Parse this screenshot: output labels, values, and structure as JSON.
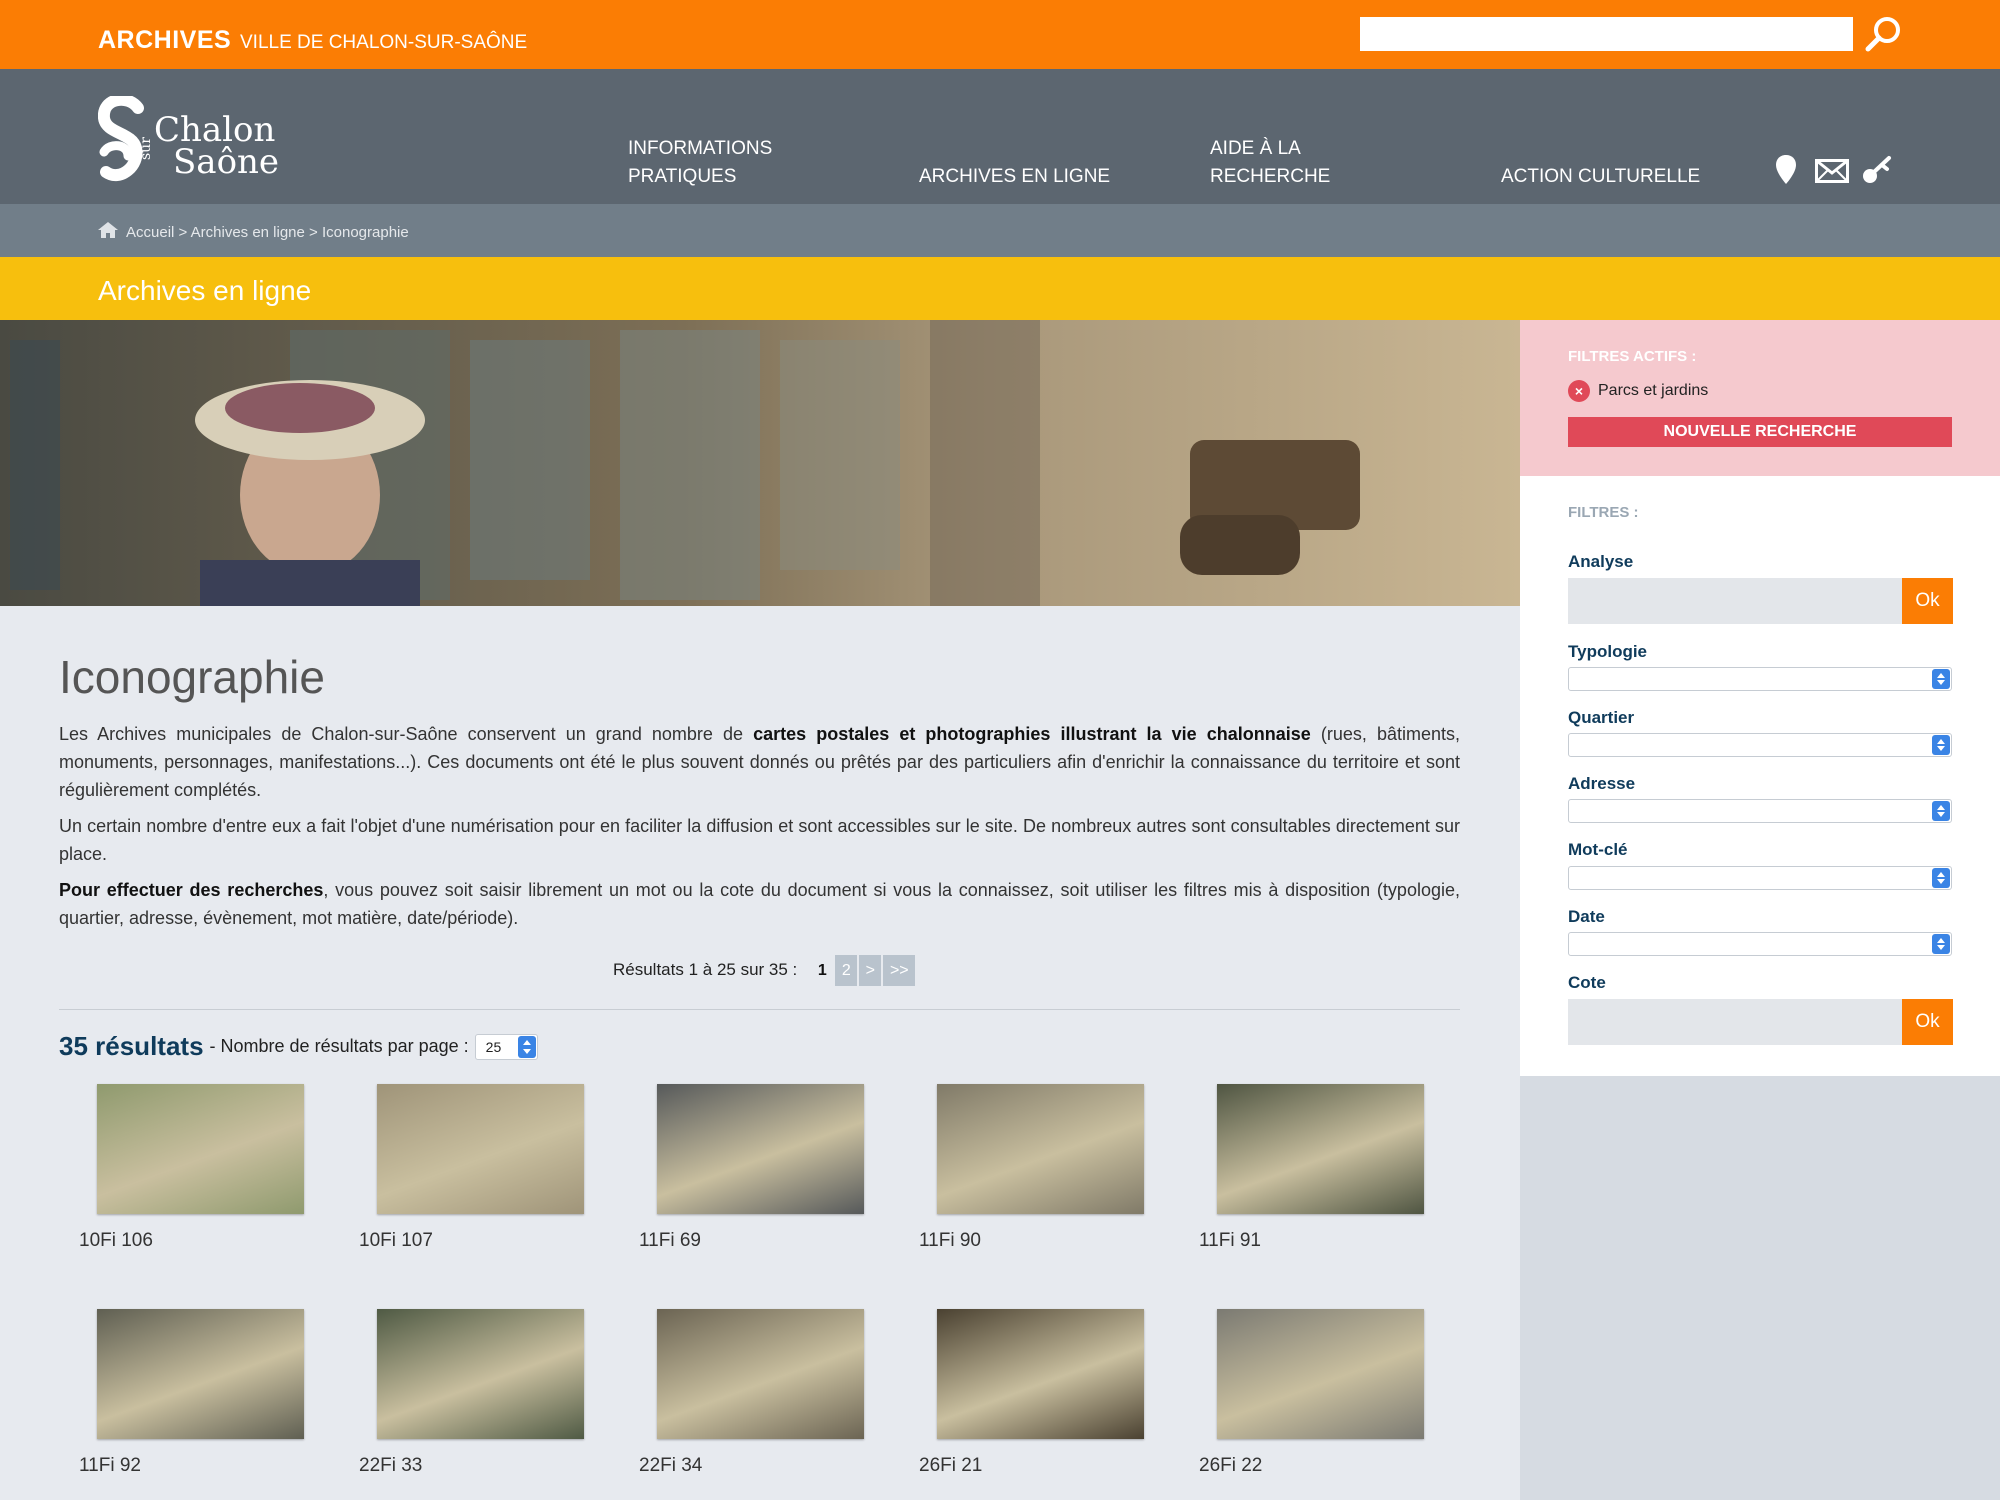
{
  "topbar": {
    "brand": "ARCHIVES",
    "city": "VILLE DE CHALON-SUR-SAÔNE",
    "search_placeholder": ""
  },
  "logo": {
    "line1": "Chalon",
    "sur": "sur",
    "line2": "Saône"
  },
  "nav": {
    "items": [
      {
        "label": "INFORMATIONS PRATIQUES"
      },
      {
        "label": "ARCHIVES EN LIGNE"
      },
      {
        "label": "AIDE À LA RECHERCHE"
      },
      {
        "label": "ACTION CULTURELLE"
      }
    ],
    "icons": [
      "map-pin-icon",
      "mail-icon",
      "key-icon"
    ]
  },
  "breadcrumb": {
    "home": "Accueil",
    "sep": " > ",
    "level1": "Archives en ligne",
    "level2": "Iconographie"
  },
  "section_title": "Archives en ligne",
  "page": {
    "title": "Iconographie",
    "p1_a": "Les Archives municipales de Chalon-sur-Saône conservent un grand nombre de ",
    "p1_b": "cartes postales et photographies illustrant la vie chalonnaise",
    "p1_c": " (rues, bâtiments, monuments, personnages, manifestations...). Ces documents ont été le plus souvent donnés ou prêtés par des particuliers afin d'enrichir la connaissance du territoire et sont régulièrement complétés.",
    "p2": "Un certain nombre d'entre eux a fait l'objet d'une numérisation pour en faciliter la diffusion et sont accessibles sur le site. De nombreux autres sont consultables directement sur place.",
    "p3_a": "Pour effectuer des recherches",
    "p3_b": ", vous pouvez soit saisir librement un mot ou la cote du document si vous la connaissez, soit utiliser les filtres mis à disposition (typologie, quartier, adresse, évènement, mot matière, date/période)."
  },
  "pager": {
    "summary": "Résultats 1 à 25 sur 35 :",
    "current": "1",
    "page2": "2",
    "next": ">",
    "last": ">>"
  },
  "results": {
    "count": "35 résultats",
    "per_page_label": "- Nombre de résultats par page :",
    "per_page_value": "25",
    "items": [
      {
        "code": "10Fi 106",
        "tone": "#8f9a6e"
      },
      {
        "code": "10Fi 107",
        "tone": "#9f9479"
      },
      {
        "code": "11Fi 69",
        "tone": "#56595a"
      },
      {
        "code": "11Fi 90",
        "tone": "#807a68"
      },
      {
        "code": "11Fi 91",
        "tone": "#4f5542"
      },
      {
        "code": "11Fi 92",
        "tone": "#5f5f52"
      },
      {
        "code": "22Fi 33",
        "tone": "#4f5a44"
      },
      {
        "code": "22Fi 34",
        "tone": "#6b6453"
      },
      {
        "code": "26Fi 21",
        "tone": "#4a4131"
      },
      {
        "code": "26Fi 22",
        "tone": "#7b7a72"
      }
    ]
  },
  "sidebar": {
    "active_title": "FILTRES ACTIFS :",
    "active_filter": "Parcs et jardins",
    "new_search": "NOUVELLE RECHERCHE",
    "filters_title": "FILTRES :",
    "analyse": "Analyse",
    "typologie": "Typologie",
    "quartier": "Quartier",
    "adresse": "Adresse",
    "motcle": "Mot-clé",
    "date": "Date",
    "cote": "Cote",
    "ok": "Ok"
  },
  "colors": {
    "orange": "#fb7d04",
    "nav": "#5c6670",
    "yellow": "#f7bf0d",
    "red": "#e04958",
    "navy": "#0f3b5b"
  }
}
